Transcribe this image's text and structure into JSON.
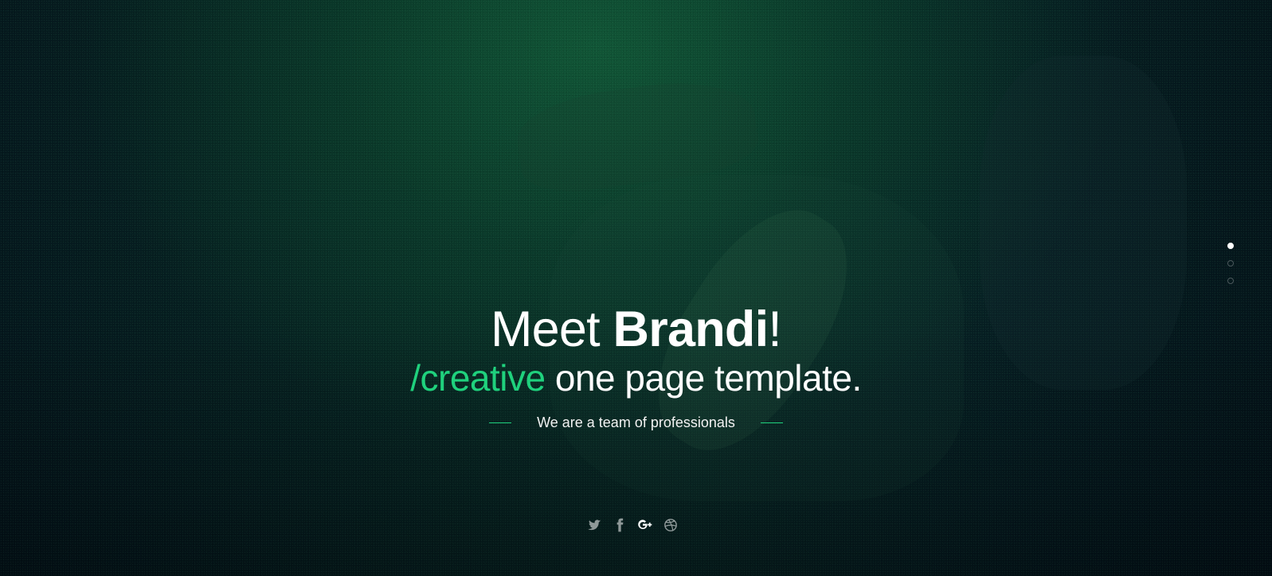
{
  "hero": {
    "headline": {
      "prefix": "Meet ",
      "brand": "Brandi",
      "suffix": "!"
    },
    "subheadline": {
      "accent": "/creative",
      "rest": " one page template."
    },
    "tagline": "We are a team of professionals"
  },
  "slider": {
    "count": 3,
    "active": 1
  },
  "social": {
    "items": [
      {
        "name": "twitter",
        "icon": "twitter-icon"
      },
      {
        "name": "facebook",
        "icon": "facebook-icon"
      },
      {
        "name": "google-plus",
        "icon": "google-plus-icon"
      },
      {
        "name": "dribbble",
        "icon": "dribbble-icon"
      }
    ],
    "active": "google-plus"
  },
  "colors": {
    "accent": "#1fd17d",
    "text": "#ffffff",
    "muted": "#8ea3a0"
  }
}
